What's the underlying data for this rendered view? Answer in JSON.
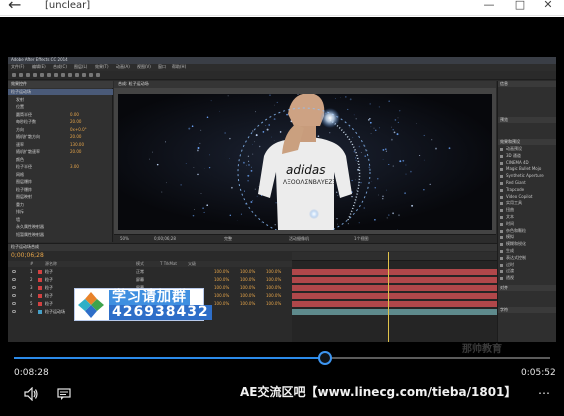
{
  "window": {
    "title": "[unclear]",
    "back_glyph": "←",
    "minimize_glyph": "—",
    "maximize_glyph": "□",
    "close_glyph": "✕"
  },
  "ae": {
    "window_title": "Adobe After Effects CC 2014",
    "menus": [
      "文件(F)",
      "编辑(E)",
      "合成(C)",
      "图层(L)",
      "效果(T)",
      "动画(A)",
      "视图(V)",
      "窗口",
      "帮助(H)"
    ],
    "effect_panel_tab": "效果控件",
    "effect_props": [
      {
        "name": "粒子运动场",
        "value": ""
      },
      {
        "name": "发射",
        "value": ""
      },
      {
        "name": "位置",
        "value": ""
      },
      {
        "name": "圆筒半径",
        "value": "0.00"
      },
      {
        "name": "每秒粒子数",
        "value": "20.00"
      },
      {
        "name": "方向",
        "value": "0x+0.0°"
      },
      {
        "name": "随机扩散方向",
        "value": "20.00"
      },
      {
        "name": "速率",
        "value": "130.00"
      },
      {
        "name": "随机扩散速率",
        "value": "20.00"
      },
      {
        "name": "颜色",
        "value": ""
      },
      {
        "name": "粒子半径",
        "value": "3.00"
      },
      {
        "name": "网格",
        "value": ""
      },
      {
        "name": "图层爆炸",
        "value": ""
      },
      {
        "name": "粒子爆炸",
        "value": ""
      },
      {
        "name": "图层映射",
        "value": ""
      },
      {
        "name": "重力",
        "value": ""
      },
      {
        "name": "排斥",
        "value": ""
      },
      {
        "name": "墙",
        "value": ""
      },
      {
        "name": "永久属性映射器",
        "value": ""
      },
      {
        "name": "短暂属性映射器",
        "value": ""
      }
    ],
    "viewer_tab": "合成: 粒子运动场",
    "shirt_text_1": "adidas",
    "shirt_text_2": "ΛΞΟΟΛΣΝΒΛΥΕΖΞ",
    "viewer_controls": [
      "50%",
      "0;00;06;28",
      "完整",
      "活动摄像机",
      "1个视图"
    ],
    "right_panels": {
      "info_head": "信息",
      "preview_head": "预览",
      "effects_head": "效果和预设",
      "effects": [
        "动画预设",
        "3D 通道",
        "CINEMA 4D",
        "Magic Bullet Mojo",
        "Synthetic Aperture",
        "Red Giant",
        "Trapcode",
        "Video Copilot",
        "实用工具",
        "扭曲",
        "文本",
        "时间",
        "杂色和颗粒",
        "模拟",
        "模糊和锐化",
        "生成",
        "表达式控制",
        "过时",
        "过渡",
        "透视"
      ],
      "align_head": "对齐",
      "character_head": "字符"
    },
    "timeline": {
      "tab": "粒子运动场合成",
      "time": "0;00;06;28",
      "columns": [
        "#",
        "源名称",
        "模式",
        "T TrkMat",
        "父级"
      ],
      "layers": [
        {
          "num": "1",
          "name": "粒子",
          "color": "#d24141",
          "mode": "正常",
          "vals": [
            "100.0%",
            "100.0%",
            "100.0%"
          ]
        },
        {
          "num": "2",
          "name": "粒子",
          "color": "#d24141",
          "mode": "屏幕",
          "vals": [
            "100.0%",
            "100.0%",
            "100.0%"
          ]
        },
        {
          "num": "3",
          "name": "粒子",
          "color": "#d24141",
          "mode": "屏幕",
          "vals": [
            "100.0%",
            "100.0%",
            "100.0%"
          ]
        },
        {
          "num": "4",
          "name": "粒子",
          "color": "#d24141",
          "mode": "正常",
          "vals": [
            "100.0%",
            "100.0%",
            "100.0%"
          ]
        },
        {
          "num": "5",
          "name": "粒子",
          "color": "#d24141",
          "mode": "正常",
          "vals": [
            "100.0%",
            "100.0%",
            "100.0%"
          ]
        },
        {
          "num": "6",
          "name": "粒子运动场",
          "color": "#46a0c8",
          "mode": "正常",
          "vals": [
            "",
            "",
            ""
          ]
        }
      ]
    }
  },
  "banner": {
    "line1": "学习请加群",
    "line2": "426938432"
  },
  "edu_watermark": "那帅教育",
  "player": {
    "current_time": "0:08:28",
    "total_time": "0:05:52",
    "progress_fraction": 0.58,
    "overlay_text": "AE交流区吧【www.linecg.com/tieba/1801】",
    "more_glyph": "…",
    "accent": "#2b8ae8"
  }
}
